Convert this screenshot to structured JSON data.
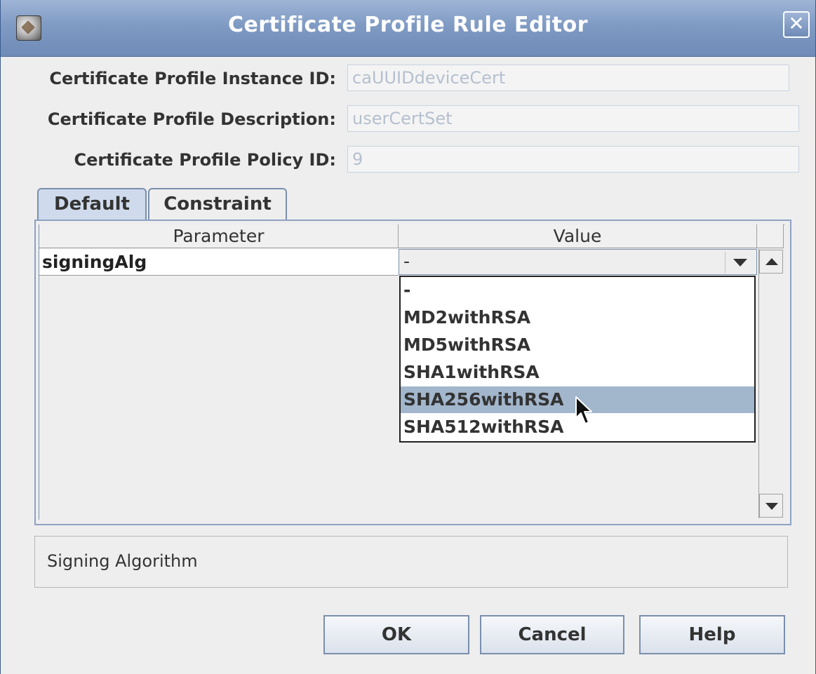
{
  "window": {
    "title": "Certificate Profile Rule Editor"
  },
  "fields": {
    "instance_id": {
      "label": "Certificate Profile Instance ID:",
      "value": "caUUIDdeviceCert"
    },
    "description": {
      "label": "Certificate Profile Description:",
      "value": "userCertSet"
    },
    "policy_id": {
      "label": "Certificate Profile Policy ID:",
      "value": "9"
    }
  },
  "tabs": [
    {
      "label": "Default",
      "active": true
    },
    {
      "label": "Constraint",
      "active": false
    }
  ],
  "table": {
    "headers": [
      "Parameter",
      "Value"
    ],
    "rows": [
      {
        "parameter": "signingAlg",
        "value": "-"
      }
    ]
  },
  "dropdown": {
    "options": [
      "-",
      "MD2withRSA",
      "MD5withRSA",
      "SHA1withRSA",
      "SHA256withRSA",
      "SHA512withRSA"
    ],
    "highlighted": "SHA256withRSA"
  },
  "description": "Signing Algorithm",
  "buttons": {
    "ok": "OK",
    "cancel": "Cancel",
    "help": "Help"
  }
}
